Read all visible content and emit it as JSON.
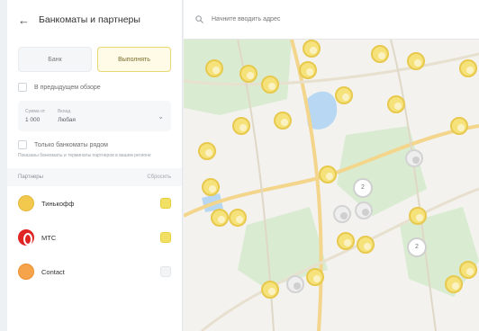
{
  "panel": {
    "title": "Банкоматы и партнеры",
    "tabs": [
      "Банк",
      "Выполнять"
    ],
    "checkbox_1": "В предыдущем обзоре",
    "select": {
      "caption_1": "Сумма от",
      "value_1": "1 000",
      "caption_2": "Вклад",
      "value_2": "Любая"
    },
    "checkbox_2": "Только банкоматы рядом",
    "note": "Показаны банкоматы и терминалы партнеров в вашем регионе",
    "partners": {
      "header": "Партнеры",
      "action": "Сбросить",
      "items": [
        {
          "name": "Тинькофф",
          "selected": true,
          "logo": "tinkoff"
        },
        {
          "name": "МТС",
          "selected": true,
          "logo": "mts"
        },
        {
          "name": "Contact",
          "selected": false,
          "logo": "contact"
        }
      ]
    }
  },
  "map": {
    "search_placeholder": "Начните вводить адрес",
    "clusters": [
      "2",
      "2"
    ]
  },
  "colors": {
    "accent_yellow": "#f6e27a",
    "pin_border": "#e7c94d",
    "map_bg": "#f3f2ee",
    "water": "#b8d7f3",
    "park": "#d9ecd2",
    "road_yellow": "#f3d58c"
  },
  "icons": {
    "back": "arrow-left-icon",
    "search": "search-icon",
    "chevron": "chevron-down-icon",
    "pin": "map-pin-icon"
  }
}
